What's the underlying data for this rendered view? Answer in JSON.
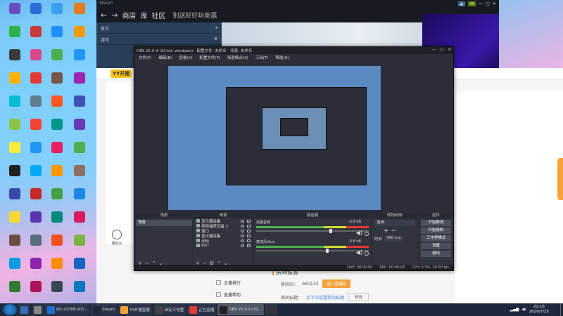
{
  "desktop": {
    "icons": [
      {
        "label": "…",
        "color": "#6b4bc2"
      },
      {
        "label": "…",
        "color": "#2c6bd8"
      },
      {
        "label": "…",
        "color": "#3aa0f0"
      },
      {
        "label": "…",
        "color": "#e57a22"
      },
      {
        "label": "…",
        "color": "#2bb24c"
      },
      {
        "label": "…",
        "color": "#c83a3a"
      },
      {
        "label": "…",
        "color": "#1e90ff"
      },
      {
        "label": "…",
        "color": "#ff9a00"
      },
      {
        "label": "…",
        "color": "#3a3a3a"
      },
      {
        "label": "…",
        "color": "#d94a8a"
      },
      {
        "label": "…",
        "color": "#4caf50"
      },
      {
        "label": "…",
        "color": "#2196f3"
      },
      {
        "label": "…",
        "color": "#ffb300"
      },
      {
        "label": "…",
        "color": "#e53935"
      },
      {
        "label": "…",
        "color": "#795548"
      },
      {
        "label": "…",
        "color": "#9c27b0"
      },
      {
        "label": "…",
        "color": "#00bcd4"
      },
      {
        "label": "…",
        "color": "#607d8b"
      },
      {
        "label": "…",
        "color": "#ff5722"
      },
      {
        "label": "…",
        "color": "#3f51b5"
      },
      {
        "label": "…",
        "color": "#8bc34a"
      },
      {
        "label": "…",
        "color": "#f44336"
      },
      {
        "label": "…",
        "color": "#009688"
      },
      {
        "label": "…",
        "color": "#673ab7"
      },
      {
        "label": "…",
        "color": "#ffeb3b"
      },
      {
        "label": "…",
        "color": "#2196f3"
      },
      {
        "label": "…",
        "color": "#e91e63"
      },
      {
        "label": "…",
        "color": "#4caf50"
      },
      {
        "label": "…",
        "color": "#212121"
      },
      {
        "label": "…",
        "color": "#03a9f4"
      },
      {
        "label": "…",
        "color": "#ff9800"
      },
      {
        "label": "…",
        "color": "#8d6e63"
      },
      {
        "label": "…",
        "color": "#3949ab"
      },
      {
        "label": "…",
        "color": "#c62828"
      },
      {
        "label": "…",
        "color": "#43a047"
      },
      {
        "label": "…",
        "color": "#1e88e5"
      },
      {
        "label": "…",
        "color": "#fdd835"
      },
      {
        "label": "…",
        "color": "#5e35b1"
      },
      {
        "label": "…",
        "color": "#00897b"
      },
      {
        "label": "…",
        "color": "#d81b60"
      },
      {
        "label": "…",
        "color": "#6d4c41"
      },
      {
        "label": "…",
        "color": "#546e7a"
      },
      {
        "label": "…",
        "color": "#f4511e"
      },
      {
        "label": "…",
        "color": "#7cb342"
      },
      {
        "label": "…",
        "color": "#039be5"
      },
      {
        "label": "…",
        "color": "#8e24aa"
      },
      {
        "label": "…",
        "color": "#fb8c00"
      },
      {
        "label": "…",
        "color": "#1565c0"
      },
      {
        "label": "…",
        "color": "#2e7d32"
      },
      {
        "label": "…",
        "color": "#ad1457"
      },
      {
        "label": "…",
        "color": "#37474f"
      },
      {
        "label": "…",
        "color": "#0277bd"
      }
    ]
  },
  "steam": {
    "nav_tabs": [
      "商店",
      "社区"
    ],
    "game_title": "别送好好玩能赢",
    "chips": [
      "▲",
      "✉"
    ],
    "left_rows": [
      "首页",
      "游戏"
    ],
    "left_rows2": [
      "YY开播"
    ]
  },
  "yy": {
    "logo": "YY开播",
    "sidebar_label": "播放头",
    "settings_title": "房间设置",
    "room_label": "房间ID：",
    "room_id": "660133",
    "room_button": "进入直播间",
    "title_label": "房间标题：",
    "title_link": "点下中设置您的标题",
    "edit_button": "修改",
    "menu": [
      "主播排行",
      "直播帮助"
    ]
  },
  "obs": {
    "title": "OBS 25.0.4 (32-bit, windows) - 配置文件: 未命名 - 场景: 未命名",
    "menus": [
      "文件(F)",
      "编辑(E)",
      "查看(V)",
      "配置文件(P)",
      "场景集合(S)",
      "工具(T)",
      "帮助(H)"
    ],
    "docks": {
      "scenes": "场景",
      "sources": "来源",
      "mixer": "混音器",
      "transitions": "转场特效",
      "controls": "控件"
    },
    "scene_items": [
      "场景"
    ],
    "source_items": [
      "显示器采集",
      "视频捕获设备 2",
      "窗口",
      "显示器采集",
      "光标",
      "BGT"
    ],
    "mixer_channels": [
      {
        "name": "桌面音频",
        "db": "-5.8 dB",
        "level": 0.65
      },
      {
        "name": "麦克风/Aux",
        "db": "-5.8 dB",
        "level": 0.62
      }
    ],
    "transition": "淡出",
    "duration_label": "时长",
    "duration": "300 ms",
    "controls": [
      "开始推流",
      "开始录制",
      "工作室模式",
      "设置",
      "退出"
    ],
    "status": [
      "LIVE: 00:00:00",
      "REC: 00:00:00",
      "CPU: 6.9%, 30.00 fps"
    ]
  },
  "taskbar": {
    "items": [
      {
        "label": "",
        "color": "#3a6ab8"
      },
      {
        "label": "",
        "color": "#888"
      },
      {
        "label": "RU-21588-0(f)...",
        "color": "#1e6fd0"
      },
      {
        "label": "Steam",
        "color": "#1b2838"
      },
      {
        "label": "YY开播直播",
        "color": "#f6a23a"
      },
      {
        "label": "自定义设置",
        "color": "#444"
      },
      {
        "label": "正在直播",
        "color": "#e53935"
      },
      {
        "label": "OBS 25.0.4 (32...",
        "color": "#222"
      },
      {
        "label": "",
        "color": "#333"
      }
    ],
    "time": "22:16",
    "date": "2020/7/25"
  }
}
